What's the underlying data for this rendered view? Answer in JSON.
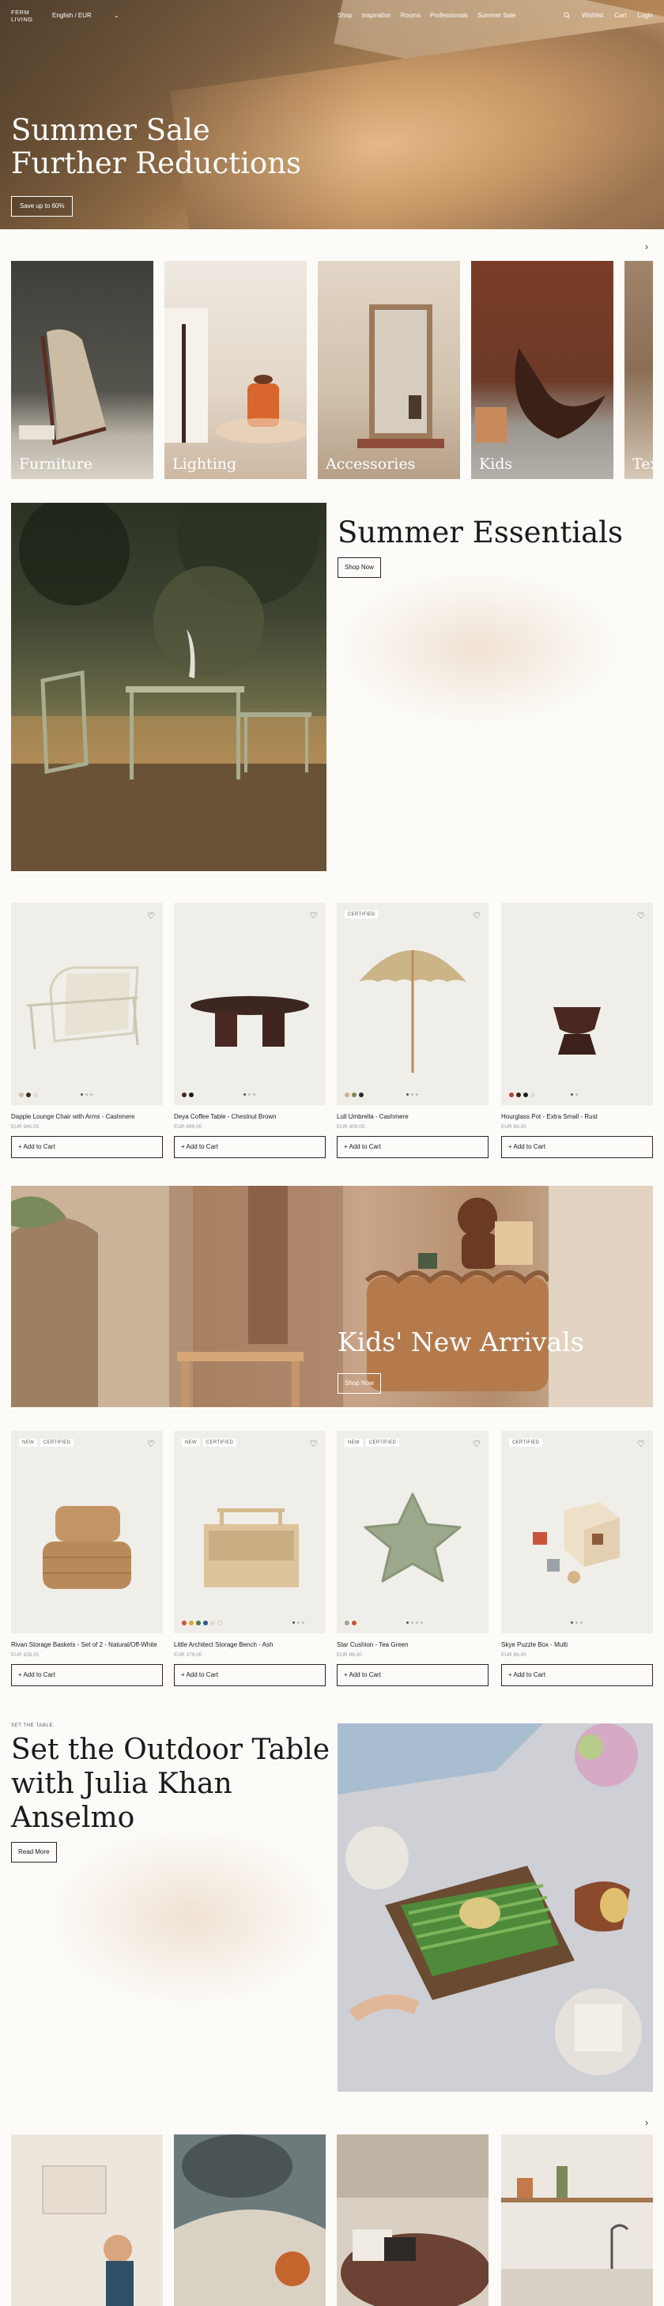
{
  "header": {
    "logo_line1": "FERM",
    "logo_line2": "LIVING",
    "language": "English / EUR",
    "nav": [
      "Shop",
      "Inspiration",
      "Rooms",
      "Professionals",
      "Summer Sale"
    ],
    "wishlist": "Wishlist",
    "cart": "Cart",
    "login": "Login"
  },
  "hero": {
    "title_line1": "Summer Sale",
    "title_line2": "Further Reductions",
    "cta": "Save up to 60%"
  },
  "categories": [
    "Furniture",
    "Lighting",
    "Accessories",
    "Kids",
    "Textiles"
  ],
  "essentials": {
    "title": "Summer Essentials",
    "cta": "Shop Now"
  },
  "products": [
    {
      "name": "Dapple Lounge Chair with Arms - Cashmere",
      "price": "EUR 945,00",
      "badges": [],
      "swatches": [
        "#c9bfae",
        "#3a2a22",
        "#e1ddd4"
      ],
      "add": "+ Add to Cart"
    },
    {
      "name": "Deya Coffee Table - Chestnut Brown",
      "price": "EUR 899,00",
      "badges": [],
      "swatches": [
        "#4a2822",
        "#1e1b18"
      ],
      "add": "+ Add to Cart"
    },
    {
      "name": "Lull Umbrella - Cashmere",
      "price": "EUR 409,00",
      "badges": [
        "CERTIFIED"
      ],
      "swatches": [
        "#c9b48a",
        "#7c8a55",
        "#2b2b2b"
      ],
      "add": "+ Add to Cart"
    },
    {
      "name": "Hourglass Pot - Extra Small - Rust",
      "price": "EUR 69,00",
      "badges": [],
      "swatches": [
        "#b4472f",
        "#3a2922",
        "#222",
        "#ddd"
      ],
      "add": "+ Add to Cart"
    }
  ],
  "kids": {
    "title": "Kids' New Arrivals",
    "cta": "Shop Now"
  },
  "kids_products": [
    {
      "name": "Rivan Storage Baskets - Set of 2 - Natural/Off-White",
      "price": "EUR 159,00",
      "badges": [
        "NEW",
        "CERTIFIED"
      ],
      "swatches": [],
      "add": "+ Add to Cart"
    },
    {
      "name": "Little Architect Storage Bench - Ash",
      "price": "EUR 379,00",
      "badges": [
        "NEW",
        "CERTIFIED"
      ],
      "swatches": [
        "#c9543b",
        "#e3a32e",
        "#4f7b4b",
        "#2c5a8f",
        "#e7d9c3",
        "#f0eee8"
      ],
      "add": "+ Add to Cart"
    },
    {
      "name": "Star Cushion - Tea Green",
      "price": "EUR 89,00",
      "badges": [
        "NEW",
        "CERTIFIED"
      ],
      "swatches": [
        "#9ca88b",
        "#c9543b"
      ],
      "add": "+ Add to Cart"
    },
    {
      "name": "Skye Puzzle Box - Multi",
      "price": "EUR 69,00",
      "badges": [
        "CERTIFIED"
      ],
      "swatches": [],
      "add": "+ Add to Cart"
    }
  ],
  "outdoor": {
    "kicker": "SET THE TABLE",
    "title": "Set the Outdoor Table with Julia Khan Anselmo",
    "cta": "Read More"
  }
}
